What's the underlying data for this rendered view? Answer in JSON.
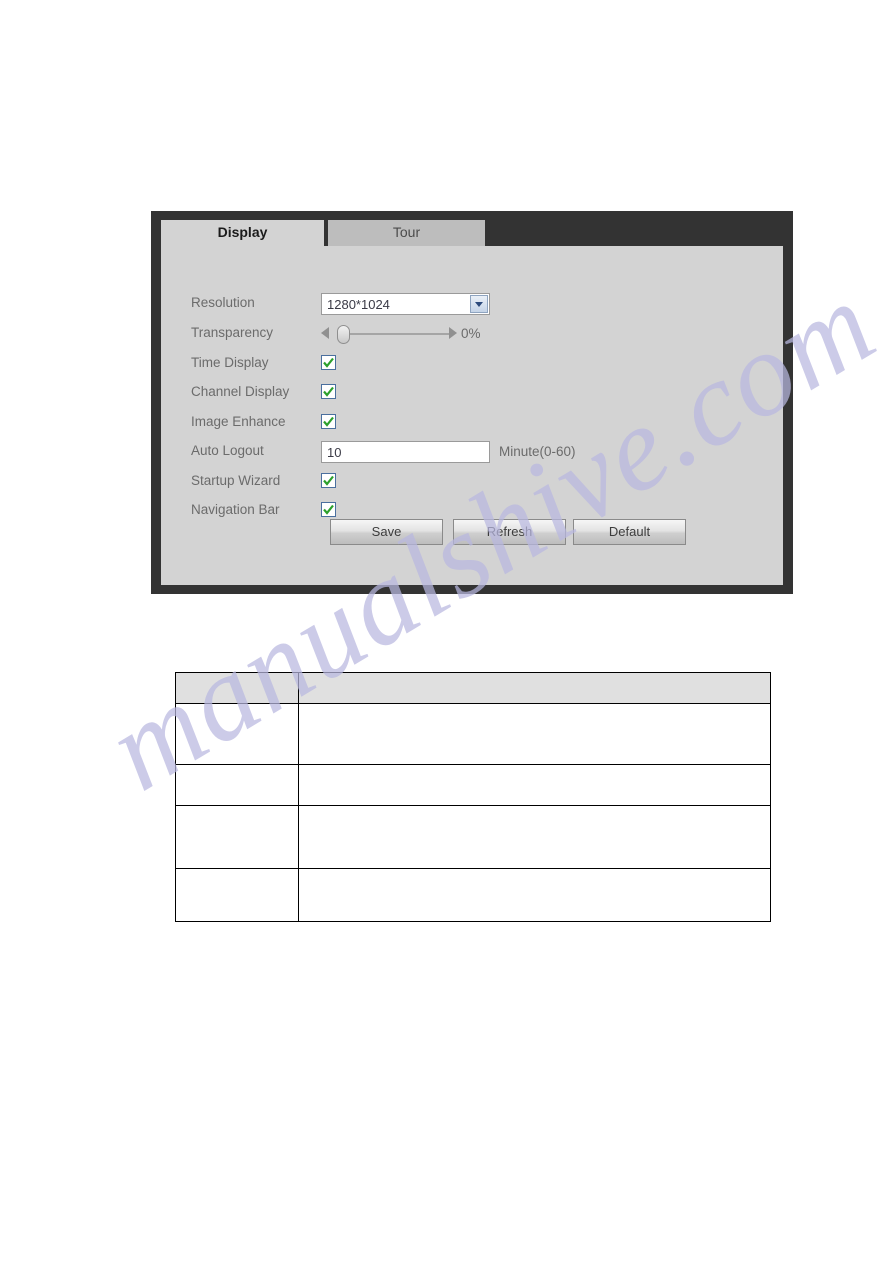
{
  "panel": {
    "tabs": [
      {
        "label": "Display",
        "active": true
      },
      {
        "label": "Tour",
        "active": false
      }
    ],
    "fields": {
      "resolution": {
        "label": "Resolution",
        "value": "1280*1024",
        "icon": "chevron-down-icon"
      },
      "transparency": {
        "label": "Transparency",
        "value": "0%",
        "left_arrow_icon": "arrow-left-icon",
        "right_arrow_icon": "arrow-right-icon"
      },
      "time_display": {
        "label": "Time Display",
        "checked": true
      },
      "channel_display": {
        "label": "Channel Display",
        "checked": true
      },
      "image_enhance": {
        "label": "Image Enhance",
        "checked": true
      },
      "auto_logout": {
        "label": "Auto Logout",
        "value": "10",
        "unit": "Minute(0-60)"
      },
      "startup_wizard": {
        "label": "Startup Wizard",
        "checked": true
      },
      "navigation_bar": {
        "label": "Navigation Bar",
        "checked": true
      }
    },
    "buttons": {
      "save": "Save",
      "refresh": "Refresh",
      "default": "Default"
    }
  },
  "description_table": {
    "header": [
      "",
      ""
    ],
    "rows": [
      [
        "",
        ""
      ],
      [
        "",
        ""
      ],
      [
        "",
        ""
      ],
      [
        "",
        ""
      ]
    ]
  },
  "watermark": {
    "text": "manualshive.com"
  },
  "colors": {
    "panel_border": "#333333",
    "panel_body": "#d3d3d3",
    "tab_active": "#d3d3d3",
    "tab_inactive": "#bdbdbd",
    "label_text": "#6b6b6b",
    "checkmark": "#2ca02c",
    "watermark": "#b9b8e0",
    "table_header": "#e0e0e0"
  }
}
